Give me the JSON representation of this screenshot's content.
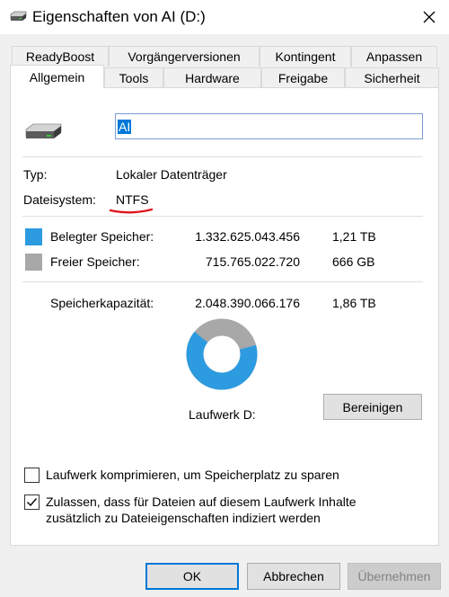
{
  "window": {
    "title": "Eigenschaften von AI (D:)",
    "close_icon": "close-icon"
  },
  "tabs_row1": [
    {
      "label": "ReadyBoost"
    },
    {
      "label": "Vorgängerversionen"
    },
    {
      "label": "Kontingent"
    },
    {
      "label": "Anpassen"
    }
  ],
  "tabs_row2": [
    {
      "label": "Allgemein",
      "active": true
    },
    {
      "label": "Tools"
    },
    {
      "label": "Hardware"
    },
    {
      "label": "Freigabe"
    },
    {
      "label": "Sicherheit"
    }
  ],
  "general": {
    "drive_name_value": "AI",
    "type_label": "Typ:",
    "type_value": "Lokaler Datenträger",
    "filesystem_label": "Dateisystem:",
    "filesystem_value": "NTFS"
  },
  "usage": {
    "used_label": "Belegter Speicher:",
    "used_bytes": "1.332.625.043.456",
    "used_human": "1,21 TB",
    "free_label": "Freier Speicher:",
    "free_bytes": "715.765.022.720",
    "free_human": "666 GB",
    "capacity_label": "Speicherkapazität:",
    "capacity_bytes": "2.048.390.066.176",
    "capacity_human": "1,86 TB",
    "used_color": "#2d9be0",
    "free_color": "#a8a8a8",
    "used_fraction": 0.6506
  },
  "drive_label": "Laufwerk D:",
  "cleanup_button": "Bereinigen",
  "options": {
    "compress_label": "Laufwerk komprimieren, um Speicherplatz zu sparen",
    "compress_checked": false,
    "index_label_line1": "Zulassen, dass für Dateien auf diesem Laufwerk Inhalte",
    "index_label_line2": "zusätzlich zu Dateieigenschaften indiziert werden",
    "index_checked": true
  },
  "buttons": {
    "ok": "OK",
    "cancel": "Abbrechen",
    "apply": "Übernehmen"
  },
  "annotation_color": "#e0141e"
}
